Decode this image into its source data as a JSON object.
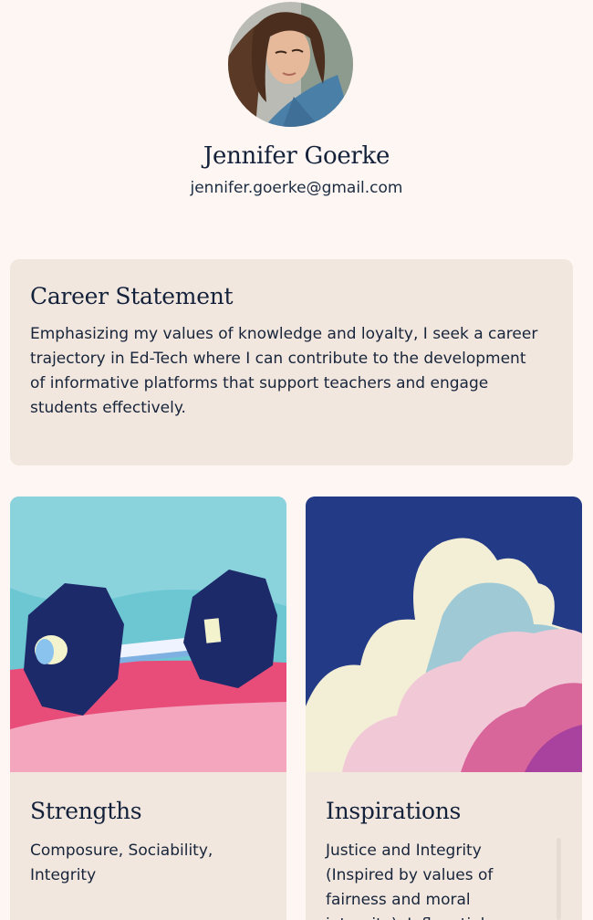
{
  "profile": {
    "name": "Jennifer Goerke",
    "email": "jennifer.goerke@gmail.com"
  },
  "career_statement": {
    "title": "Career Statement",
    "text": "Emphasizing my values of knowledge and loyalty, I seek a career trajectory in Ed-Tech where I can contribute to the development of informative platforms that support teachers and engage students effectively."
  },
  "cards": [
    {
      "title": "Strengths",
      "text": "Composure, Sociability, Integrity",
      "art": "dumbbell-illustration"
    },
    {
      "title": "Inspirations",
      "text": "Justice and Integrity (Inspired by values of fairness and moral integrity), Influential",
      "art": "clouds-illustration"
    }
  ],
  "colors": {
    "page_background": "#fdf6f2",
    "card_background": "#f1e7df",
    "heading_text": "#14213a"
  }
}
